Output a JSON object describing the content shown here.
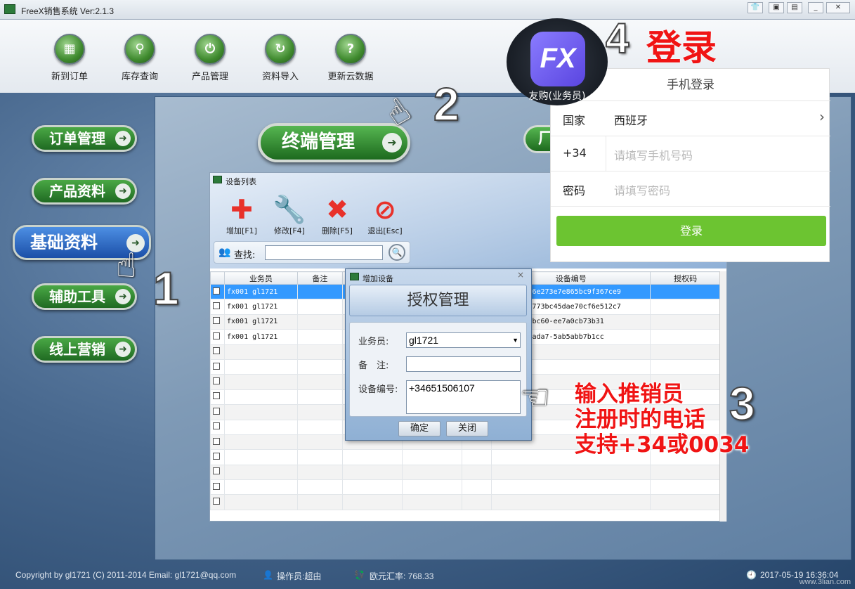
{
  "window": {
    "title": "FreeX销售系统 Ver:2.1.3"
  },
  "toolbar": [
    {
      "label": "新到订单",
      "icon": "grid-icon"
    },
    {
      "label": "库存查询",
      "icon": "magnifier-icon"
    },
    {
      "label": "产品管理",
      "icon": "power-icon"
    },
    {
      "label": "资料导入",
      "icon": "refresh-icon"
    },
    {
      "label": "更新云数据",
      "icon": "question-icon"
    }
  ],
  "sidebar": [
    {
      "label": "订单管理"
    },
    {
      "label": "产品资料"
    },
    {
      "label": "基础资料",
      "active": true
    },
    {
      "label": "辅助工具"
    },
    {
      "label": "线上营销"
    }
  ],
  "main": {
    "terminal_button": "终端管理",
    "partial_button": "厂"
  },
  "device_window": {
    "title": "设备列表",
    "tools": [
      {
        "label": "增加[F1]",
        "icon": "plus-icon",
        "color": "#e8312a"
      },
      {
        "label": "修改[F4]",
        "icon": "wrench-icon",
        "color": "#e8312a"
      },
      {
        "label": "删除[F5]",
        "icon": "delete-icon",
        "color": "#e8312a"
      },
      {
        "label": "退出[Esc]",
        "icon": "exit-icon",
        "color": "#e8312a"
      }
    ],
    "search_label": "查找:",
    "columns": [
      "业务员",
      "备注",
      "",
      "",
      "",
      "设备编号",
      "授权码"
    ],
    "rows": [
      {
        "rep": "fx001  gl1721",
        "device": "053b8f22d6e273e7e865bc9f367ce9"
      },
      {
        "rep": "fx001  gl1721",
        "device": "05c313be6773bc45dae70cf6e512c7"
      },
      {
        "rep": "fx001  gl1721",
        "device": "018-48b4-bc60-ee7a0cb73b31"
      },
      {
        "rep": "fx001  gl1721",
        "device": "6e1-4493-ada7-5ab5abb7b1cc"
      }
    ]
  },
  "dialog": {
    "title": "增加设备",
    "banner": "授权管理",
    "rep_label": "业务员:",
    "rep_value": "gl1721",
    "note_label": "备　注:",
    "device_label": "设备编号:",
    "device_value": "+34651506107",
    "ok": "确定",
    "close": "关闭"
  },
  "steps": {
    "one": "1",
    "two": "2",
    "three": "3",
    "four": "4",
    "login_word": "登录",
    "note_lines": [
      "输入推销员",
      "注册时的电话",
      "支持+34或0034"
    ]
  },
  "app_icon": {
    "logo": "FX",
    "label": "友购(业务员)"
  },
  "login": {
    "title": "手机登录",
    "country_label": "国家",
    "country_value": "西班牙",
    "code": "+34",
    "phone_placeholder": "请填写手机号码",
    "password_label": "密码",
    "password_placeholder": "请填写密码",
    "button": "登录",
    "button_color": "#6cc431"
  },
  "status": {
    "copyright": "Copyright by gl1721 (C) 2011-2014   Email: gl1721@qq.com",
    "operator": "操作员:超由",
    "rate": "欧元汇率: 768.33",
    "datetime": "2017-05-19 16:36:04",
    "watermark": "www.3lian.com"
  }
}
